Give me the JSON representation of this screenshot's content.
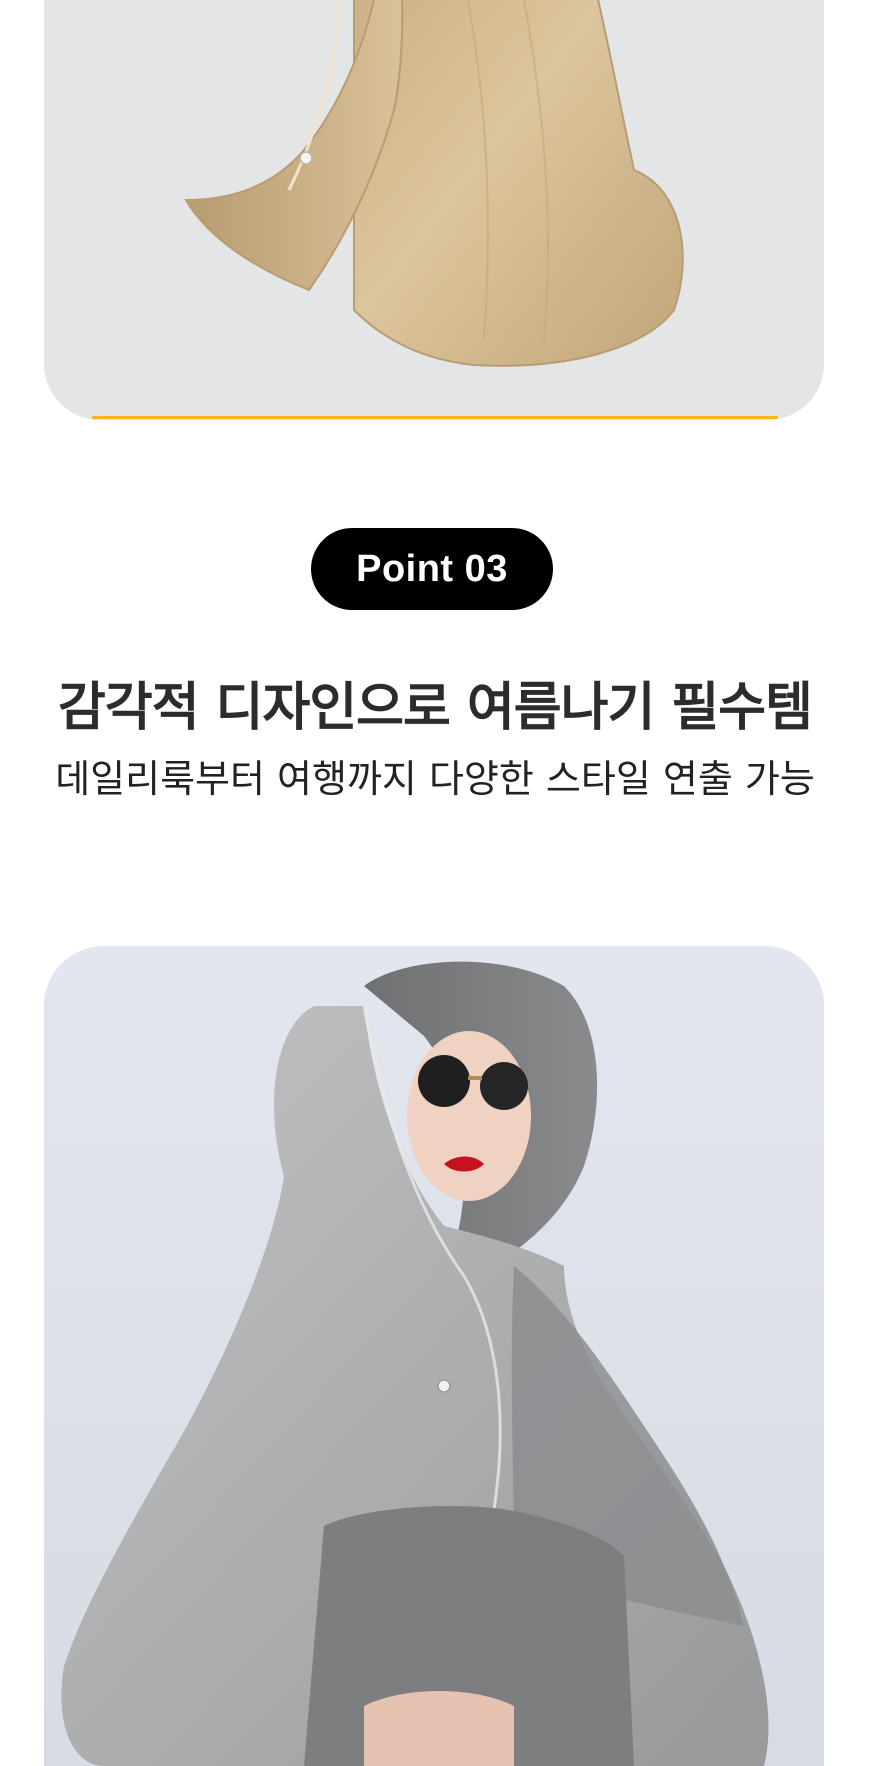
{
  "point_badge": {
    "label": "Point 03"
  },
  "headline": {
    "text": "감각적 디자인으로 여름나기 필수템"
  },
  "subline": {
    "text": "데일리룩부터 여행까지 다양한 스타일 연출 가능"
  },
  "colors": {
    "badge_bg": "#000000",
    "badge_text": "#ffffff",
    "card_bg": "#e3e5e6",
    "accent": "#f2b71a",
    "product_beige": "#d8bf96",
    "product_gray": "#a6a8aa"
  },
  "images": {
    "top": "beige-sun-hood-product-photo",
    "bottom": "model-wearing-gray-sun-hood-photo"
  }
}
